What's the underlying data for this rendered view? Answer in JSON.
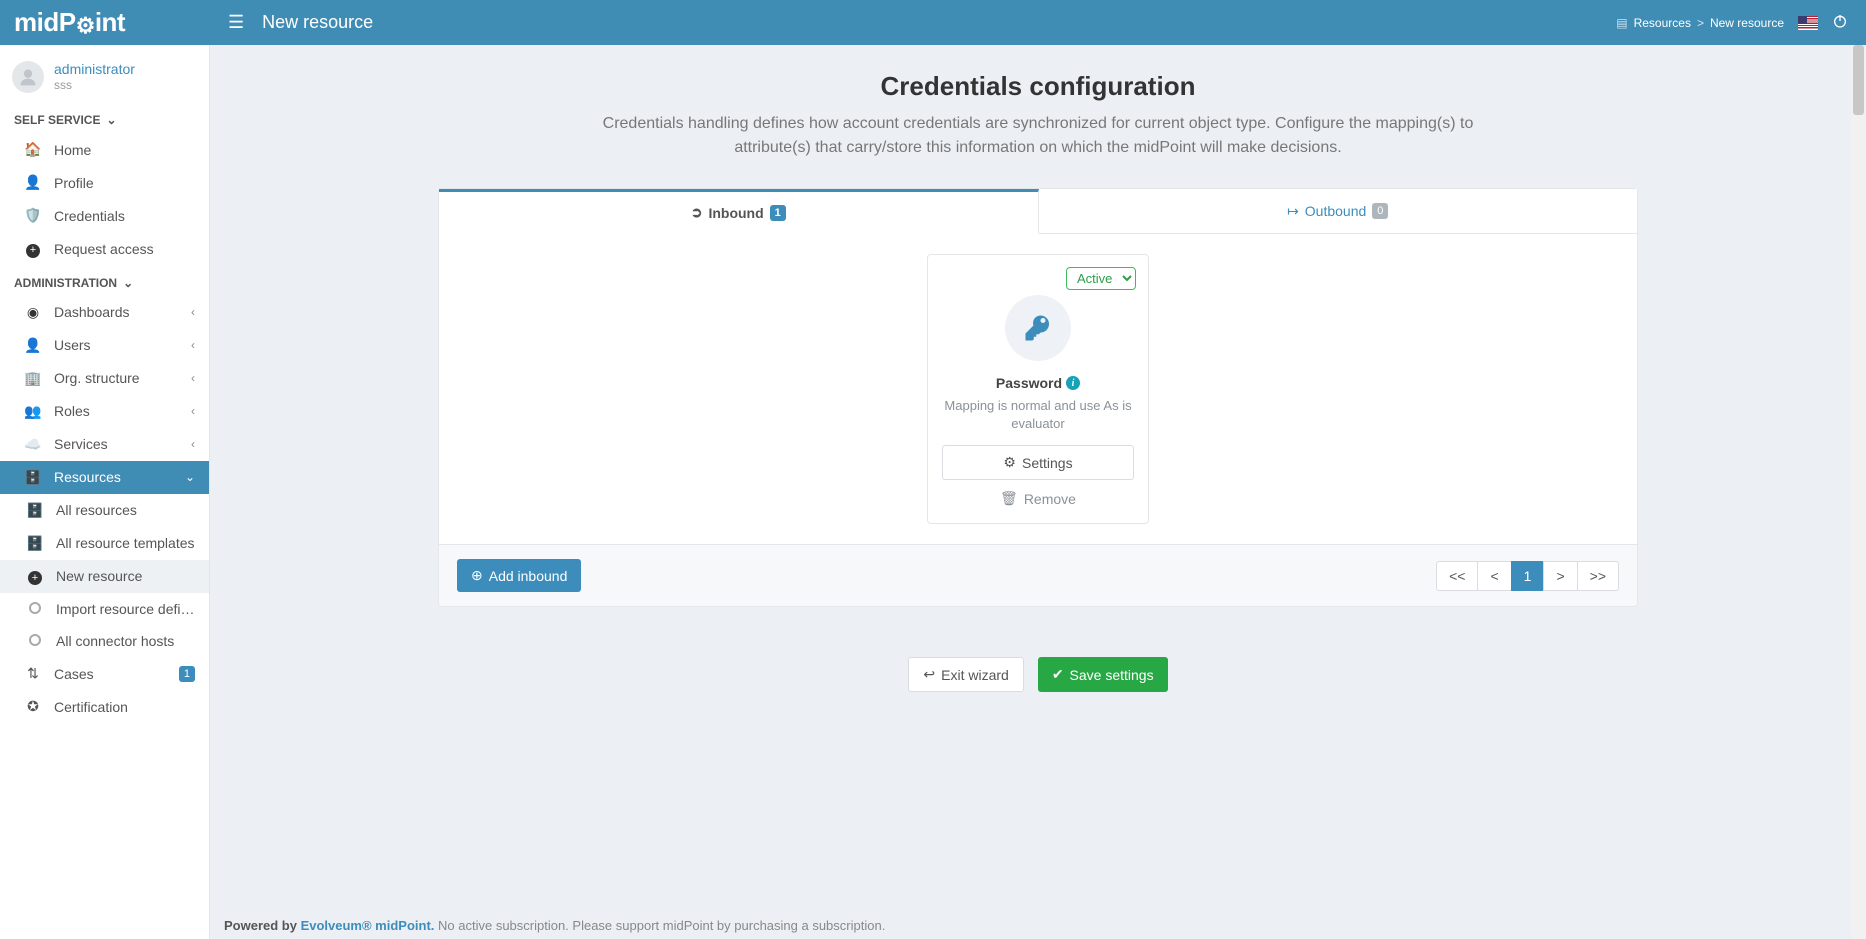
{
  "brand": "midPoint",
  "header": {
    "page_title": "New resource",
    "breadcrumb": {
      "root": "Resources",
      "current": "New resource",
      "sep": ">"
    }
  },
  "user": {
    "name": "administrator",
    "sub": "sss"
  },
  "nav": {
    "sections": {
      "self_service": "SELF SERVICE",
      "administration": "ADMINISTRATION"
    },
    "self": {
      "home": "Home",
      "profile": "Profile",
      "credentials": "Credentials",
      "request_access": "Request access"
    },
    "admin": {
      "dashboards": "Dashboards",
      "users": "Users",
      "org": "Org. structure",
      "roles": "Roles",
      "services": "Services",
      "resources": "Resources",
      "all_resources": "All resources",
      "all_templates": "All resource templates",
      "new_resource": "New resource",
      "import_def": "Import resource definit…",
      "connector_hosts": "All connector hosts",
      "cases": "Cases",
      "cases_badge": "1",
      "certification": "Certification"
    }
  },
  "wizard": {
    "title": "Credentials configuration",
    "description": "Credentials handling defines how account credentials are synchronized for current object type. Configure the mapping(s) to attribute(s) that carry/store this information on which the midPoint will make decisions."
  },
  "tabs": {
    "inbound": {
      "label": "Inbound",
      "count": "1"
    },
    "outbound": {
      "label": "Outbound",
      "count": "0"
    }
  },
  "card": {
    "status": "Active",
    "title": "Password",
    "subtitle": "Mapping is normal and use As is evaluator",
    "settings": "Settings",
    "remove": "Remove"
  },
  "actions": {
    "add_inbound": "Add inbound",
    "exit": "Exit wizard",
    "save": "Save settings"
  },
  "paginator": {
    "first": "<<",
    "prev": "<",
    "current": "1",
    "next": ">",
    "last": ">>"
  },
  "footer": {
    "powered": "Powered by ",
    "vendor": "Evolveum® midPoint.",
    "note": "  No active subscription. Please support midPoint by purchasing a subscription."
  }
}
